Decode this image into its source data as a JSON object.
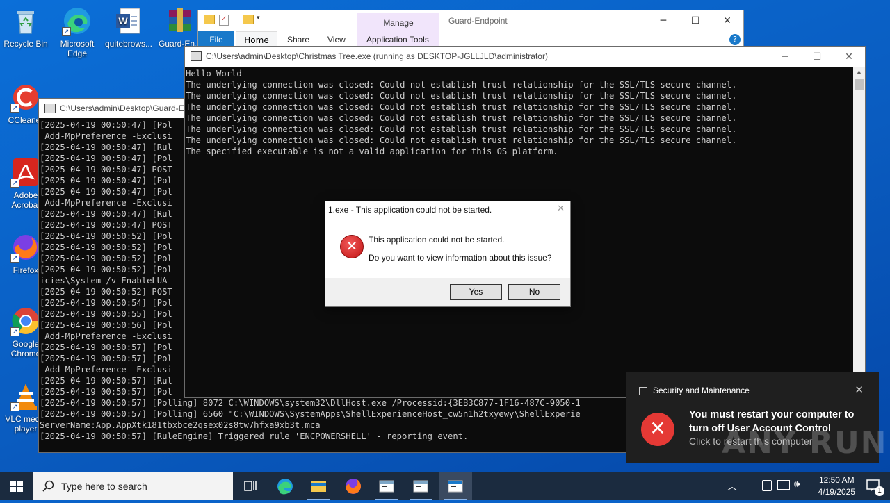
{
  "desktop": {
    "icons": [
      {
        "label": "Recycle Bin",
        "icon": "recycle-bin-icon"
      },
      {
        "label": "Microsoft Edge",
        "icon": "edge-icon"
      },
      {
        "label": "quitebrows...",
        "icon": "word-doc-icon"
      },
      {
        "label": "Guard-En...",
        "icon": "winrar-icon"
      },
      {
        "label": "CCleaner",
        "icon": "ccleaner-icon"
      },
      {
        "label": "Adobe Acrobat",
        "icon": "acrobat-icon"
      },
      {
        "label": "Firefox",
        "icon": "firefox-icon"
      },
      {
        "label": "Google Chrome",
        "icon": "chrome-icon"
      },
      {
        "label": "VLC media player",
        "icon": "vlc-icon"
      }
    ]
  },
  "explorer": {
    "title": "Guard-Endpoint",
    "manage_label": "Manage",
    "tabs": [
      "File",
      "Home",
      "Share",
      "View",
      "Application Tools"
    ]
  },
  "console_back": {
    "title": "C:\\Users\\admin\\Desktop\\Guard-E",
    "lines": [
      "[2025-04-19 00:50:47] [Pol",
      " Add-MpPreference -Exclusi",
      "[2025-04-19 00:50:47] [Rul",
      "[2025-04-19 00:50:47] [Pol",
      "[2025-04-19 00:50:47] POST",
      "[2025-04-19 00:50:47] [Pol",
      "[2025-04-19 00:50:47] [Pol",
      " Add-MpPreference -Exclusi",
      "[2025-04-19 00:50:47] [Rul",
      "[2025-04-19 00:50:47] POST",
      "[2025-04-19 00:50:52] [Pol",
      "[2025-04-19 00:50:52] [Pol",
      "[2025-04-19 00:50:52] [Pol",
      "[2025-04-19 00:50:52] [Pol",
      "icies\\System /v EnableLUA",
      "[2025-04-19 00:50:52] POST",
      "[2025-04-19 00:50:54] [Pol",
      "[2025-04-19 00:50:55] [Pol",
      "[2025-04-19 00:50:56] [Pol",
      " Add-MpPreference -Exclusi",
      "[2025-04-19 00:50:57] [Pol",
      "[2025-04-19 00:50:57] [Pol",
      " Add-MpPreference -Exclusi",
      "[2025-04-19 00:50:57] [Rul",
      "[2025-04-19 00:50:57] [Pol",
      "[2025-04-19 00:50:57] [Polling] 8072 C:\\WINDOWS\\system32\\DllHost.exe /Processid:{3EB3C877-1F16-487C-9050-1",
      "[2025-04-19 00:50:57] [Polling] 6560 \"C:\\WINDOWS\\SystemApps\\ShellExperienceHost_cw5n1h2txyewy\\ShellExperie",
      "ServerName:App.AppXtk181tbxbce2qsex02s8tw7hfxa9xb3t.mca",
      "[2025-04-19 00:50:57] [RuleEngine] Triggered rule 'ENCPOWERSHELL' - reporting event."
    ]
  },
  "console_front": {
    "title": "C:\\Users\\admin\\Desktop\\Christmas Tree.exe (running as DESKTOP-JGLLJLD\\administrator)",
    "lines": [
      "Hello World",
      "The underlying connection was closed: Could not establish trust relationship for the SSL/TLS secure channel.",
      "The underlying connection was closed: Could not establish trust relationship for the SSL/TLS secure channel.",
      "The underlying connection was closed: Could not establish trust relationship for the SSL/TLS secure channel.",
      "The underlying connection was closed: Could not establish trust relationship for the SSL/TLS secure channel.",
      "The underlying connection was closed: Could not establish trust relationship for the SSL/TLS secure channel.",
      "The underlying connection was closed: Could not establish trust relationship for the SSL/TLS secure channel.",
      "The specified executable is not a valid application for this OS platform."
    ]
  },
  "dialog": {
    "title": "1.exe - This application could not be started.",
    "message1": "This application could not be started.",
    "message2": "Do you want to view information about this issue?",
    "yes": "Yes",
    "no": "No"
  },
  "toast": {
    "app": "Security and Maintenance",
    "title": "You must restart your computer to turn off User Account Control",
    "subtitle": "Click to restart this computer"
  },
  "watermark": "ANY RUN",
  "taskbar": {
    "search_placeholder": "Type here to search",
    "time": "12:50 AM",
    "date": "4/19/2025",
    "notification_count": "1"
  },
  "colors": {
    "accent": "#1979ca",
    "error": "#e53935",
    "console_bg": "#0c0c0c",
    "console_text": "#cccccc"
  }
}
